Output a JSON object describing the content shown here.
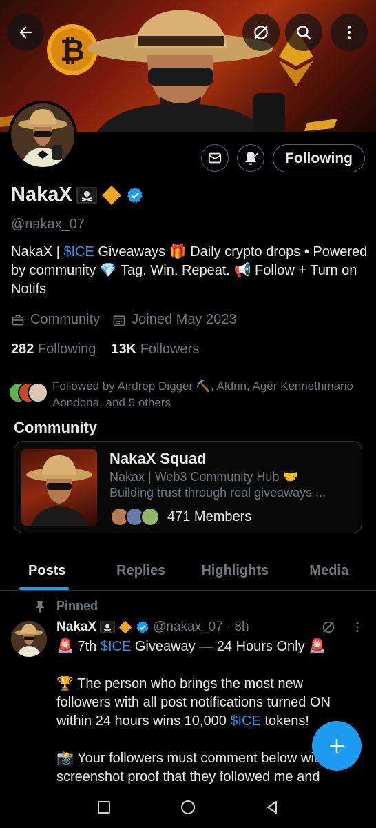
{
  "profile": {
    "name": "NakaX",
    "handle": "@nakax_07",
    "bio": {
      "line_before_link": "NakaX | ",
      "link": "$ICE",
      "line_after_link": " Giveaways 🎁 Daily crypto drops • Powered by community 💎 Tag. Win. Repeat. 📢 Follow + Turn on Notifs"
    },
    "category": "Community",
    "joined": "Joined May 2023",
    "following_count": "282",
    "following_label": "Following",
    "followers_count": "13K",
    "followers_label": "Followers",
    "followed_by": "Followed by Airdrop Digger ⛏️, Aldrin, Ager Kennethmario Aondona, and 5 others"
  },
  "actions": {
    "following_button": "Following"
  },
  "community": {
    "section_title": "Community",
    "name": "NakaX Squad",
    "desc1": "Nakax | Web3 Community Hub 🤝",
    "desc2": "Building trust through real giveaways ...",
    "members": "471 Members"
  },
  "tabs": [
    "Posts",
    "Replies",
    "Highlights",
    "Media"
  ],
  "post": {
    "pinned_label": "Pinned",
    "name": "NakaX",
    "handle": "@nakax_07",
    "time": "· 8h",
    "line1_pre": "🚨 7th ",
    "line1_link": "$ICE",
    "line1_post": " Giveaway — 24 Hours Only 🚨",
    "para2_a": "🏆 The person who brings the most new followers with all post notifications turned ON within 24 hours wins 10,000 ",
    "para2_link": "$ICE",
    "para2_b": " tokens!",
    "para3": "📸 Your followers must comment below with screenshot proof that they followed me and"
  },
  "colors": {
    "accent": "#1d9bf0",
    "muted": "#71767b",
    "text": "#e7e9ea",
    "border": "#2f3336",
    "background": "#000000"
  }
}
